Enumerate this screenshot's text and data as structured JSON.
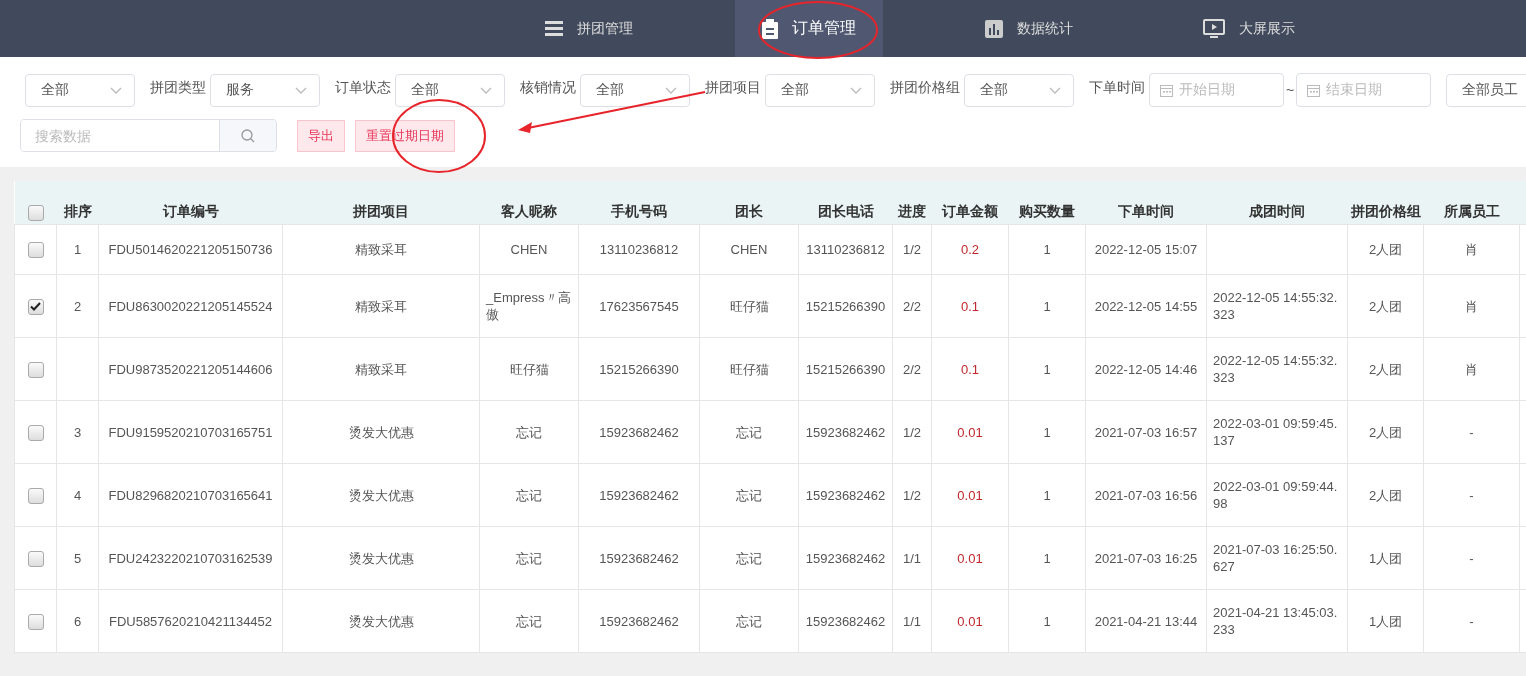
{
  "nav": {
    "tabs": [
      {
        "label": "拼团管理",
        "selected": false
      },
      {
        "label": "订单管理",
        "selected": true
      },
      {
        "label": "数据统计",
        "selected": false
      },
      {
        "label": "大屏展示",
        "selected": false
      }
    ]
  },
  "filters": [
    {
      "kind": "select",
      "value": "全部"
    },
    {
      "kind": "select",
      "label": "拼团类型",
      "value": "服务"
    },
    {
      "kind": "select",
      "label": "订单状态",
      "value": "全部"
    },
    {
      "kind": "select",
      "label": "核销情况",
      "value": "全部"
    },
    {
      "kind": "select",
      "label": "拼团项目",
      "value": "全部"
    },
    {
      "kind": "select",
      "label": "拼团价格组",
      "value": "全部"
    },
    {
      "kind": "date",
      "label": "下单时间",
      "placeholder": "开始日期"
    },
    {
      "kind": "separator",
      "label": "~"
    },
    {
      "kind": "date",
      "placeholder": "结束日期"
    },
    {
      "kind": "select",
      "value": "全部员工"
    }
  ],
  "search": {
    "placeholder": "搜索数据"
  },
  "actions": [
    "导出",
    "重置过期日期"
  ],
  "table": {
    "columns": [
      {
        "label": "排序",
        "kind": "text"
      },
      {
        "label": "订单编号",
        "kind": "text"
      },
      {
        "label": "拼团项目",
        "kind": "text"
      },
      {
        "label": "客人昵称",
        "kind": "text"
      },
      {
        "label": "手机号码",
        "kind": "text"
      },
      {
        "label": "团长",
        "kind": "text"
      },
      {
        "label": "团长电话",
        "kind": "text"
      },
      {
        "label": "进度",
        "kind": "text"
      },
      {
        "label": "订单金额",
        "kind": "money"
      },
      {
        "label": "购买数量",
        "kind": "text"
      },
      {
        "label": "下单时间",
        "kind": "text"
      },
      {
        "label": "成团时间",
        "kind": "text"
      },
      {
        "label": "拼团价格组",
        "kind": "text"
      },
      {
        "label": "所属员工",
        "kind": "text"
      }
    ],
    "all_checked": false,
    "rows": [
      {
        "checked": false,
        "cells": [
          "1",
          "FDU5014620221205150736",
          "精致采耳",
          "CHEN",
          "13110236812",
          "CHEN",
          "13110236812",
          "1/2",
          "0.2",
          "1",
          "2022-12-05 15:07",
          null,
          "2人团",
          "肖"
        ]
      },
      {
        "checked": true,
        "cells": [
          "2",
          "FDU8630020221205145524",
          "精致采耳",
          "_Empress〃高傲",
          "17623567545",
          "旺仔猫",
          "15215266390",
          "2/2",
          "0.1",
          "1",
          "2022-12-05 14:55",
          "2022-12-05 14:55:32.323",
          "2人团",
          "肖"
        ]
      },
      {
        "checked": false,
        "cells": [
          null,
          "FDU9873520221205144606",
          "精致采耳",
          "旺仔猫",
          "15215266390",
          "旺仔猫",
          "15215266390",
          "2/2",
          "0.1",
          "1",
          "2022-12-05 14:46",
          "2022-12-05 14:55:32.323",
          "2人团",
          "肖"
        ]
      },
      {
        "checked": false,
        "cells": [
          "3",
          "FDU9159520210703165751",
          "烫发大优惠",
          "忘记",
          "15923682462",
          "忘记",
          "15923682462",
          "1/2",
          "0.01",
          "1",
          "2021-07-03 16:57",
          "2022-03-01 09:59:45.137",
          "2人团",
          "-"
        ]
      },
      {
        "checked": false,
        "cells": [
          "4",
          "FDU8296820210703165641",
          "烫发大优惠",
          "忘记",
          "15923682462",
          "忘记",
          "15923682462",
          "1/2",
          "0.01",
          "1",
          "2021-07-03 16:56",
          "2022-03-01 09:59:44.98",
          "2人团",
          "-"
        ]
      },
      {
        "checked": false,
        "cells": [
          "5",
          "FDU2423220210703162539",
          "烫发大优惠",
          "忘记",
          "15923682462",
          "忘记",
          "15923682462",
          "1/1",
          "0.01",
          "1",
          "2021-07-03 16:25",
          "2021-07-03 16:25:50.627",
          "1人团",
          "-"
        ]
      },
      {
        "checked": false,
        "cells": [
          "6",
          "FDU5857620210421134452",
          "烫发大优惠",
          "忘记",
          "15923682462",
          "忘记",
          "15923682462",
          "1/1",
          "0.01",
          "1",
          "2021-04-21 13:44",
          "2021-04-21 13:45:03.233",
          "1人团",
          "-"
        ]
      }
    ]
  }
}
